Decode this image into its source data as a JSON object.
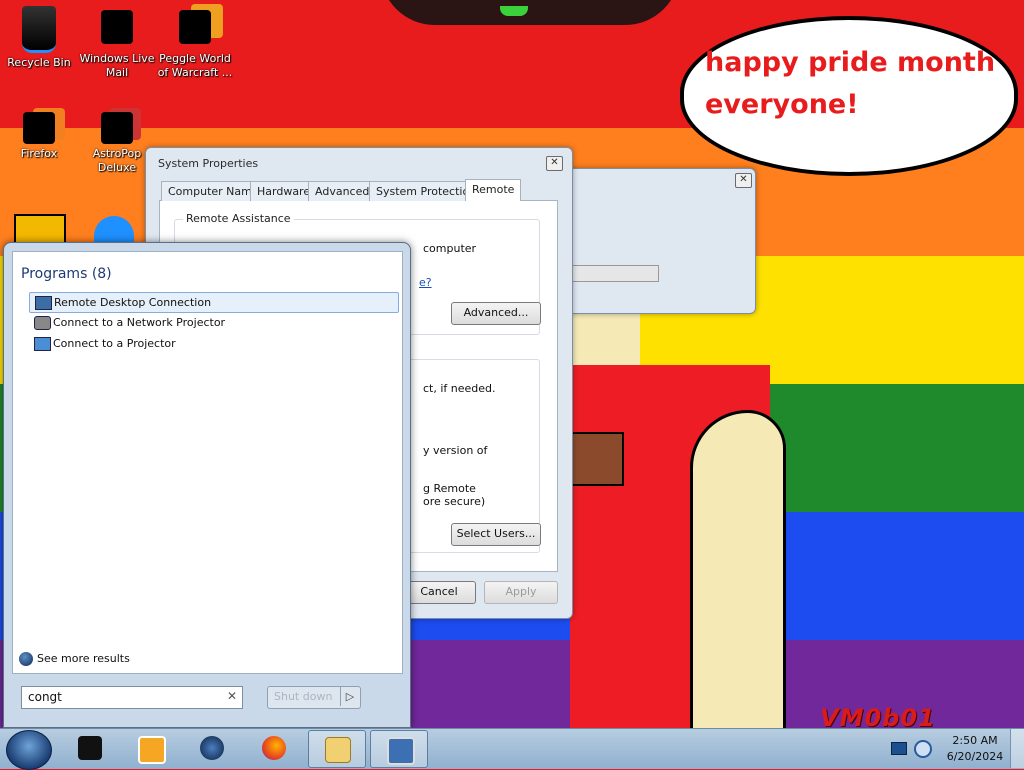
{
  "wallpaper": {
    "speech_bubble": [
      "happy pride month",
      "everyone!"
    ],
    "signature": "VM0b01",
    "stripe_colors": [
      "#e81c1c",
      "#ff7f1e",
      "#ffe100",
      "#1f8a2c",
      "#1d4cf0",
      "#70289a"
    ]
  },
  "desktop_icons": [
    {
      "label": "Recycle Bin",
      "icon": "recycle-bin-icon"
    },
    {
      "label": "Windows Live Mail",
      "icon": "mail-icon"
    },
    {
      "label": "Peggle World of Warcraft ...",
      "icon": "peggle-icon"
    },
    {
      "label": "Firefox",
      "icon": "firefox-icon"
    },
    {
      "label": "AstroPop Deluxe",
      "icon": "astropop-icon"
    }
  ],
  "system_properties": {
    "title": "System Properties",
    "tabs": [
      "Computer Name",
      "Hardware",
      "Advanced",
      "System Protection",
      "Remote"
    ],
    "active_tab": "Remote",
    "group_remote_assistance": "Remote Assistance",
    "partial_texts": {
      "computer": "computer",
      "link_tail": "e?",
      "connect_if_needed": "ct, if needed.",
      "version_of": "y version of",
      "g_remote": "g Remote",
      "more_secure": "ore secure)"
    },
    "buttons": {
      "advanced": "Advanced...",
      "select_users": "Select Users...",
      "cancel": "Cancel",
      "apply": "Apply"
    }
  },
  "start_menu": {
    "programs_header": "Programs (8)",
    "programs": [
      {
        "label": "Remote Desktop Connection",
        "icon": "remote-desktop-icon",
        "selected": true
      },
      {
        "label": "Connect to a Network Projector",
        "icon": "network-projector-icon",
        "selected": false
      },
      {
        "label": "Connect to a Projector",
        "icon": "projector-icon",
        "selected": false
      }
    ],
    "see_more": "See more results",
    "search_value": "congt",
    "shutdown_label": "Shut down"
  },
  "taskbar": {
    "items": [
      "black-app-icon",
      "media-player-icon",
      "globe-icon",
      "firefox-icon",
      "folder-explorer-icon",
      "system-properties-icon"
    ],
    "clock_time": "2:50 AM",
    "clock_date": "6/20/2024"
  }
}
